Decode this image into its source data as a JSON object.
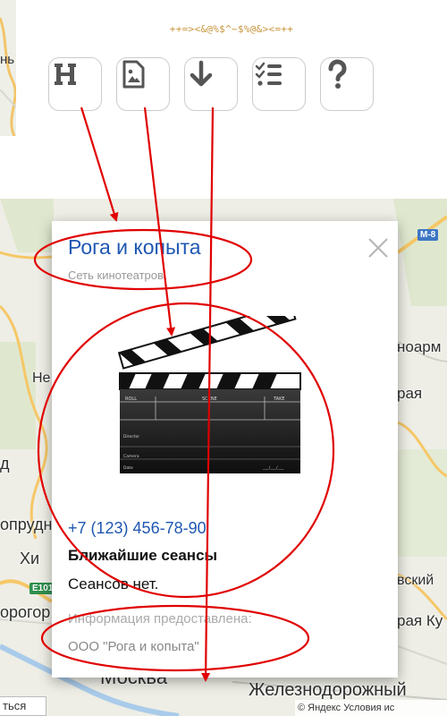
{
  "toolbar": {
    "caption": "++=><&@%$^~$%@&><=++",
    "buttons": [
      {
        "icon": "heading-icon",
        "label": "H"
      },
      {
        "icon": "image-file-icon"
      },
      {
        "icon": "arrow-down-icon"
      },
      {
        "icon": "checklist-icon"
      },
      {
        "icon": "question-icon",
        "label": "?"
      }
    ]
  },
  "map_top": {
    "label_fragment": "нь"
  },
  "map": {
    "labels": {
      "ne": "Не",
      "d": "д",
      "oprud": "опрудн",
      "khi": "Хи",
      "orogor": "орогор",
      "moskva": "Москва",
      "zheleznodorozhny": "Железнодорожный",
      "noarm": "ноарм",
      "paya": "рая",
      "rayaku": "рая Ку",
      "vsky": "вский",
      "m8": "М-8",
      "e101": "E101"
    },
    "footer_left": "ться",
    "footer_right": "© Яндекс Условия ис"
  },
  "balloon": {
    "title": "Рога и копыта",
    "subtitle": "Сеть кинотеатров",
    "clapper": {
      "roll": "ROLL",
      "scene": "SCENE",
      "take": "TAKE",
      "director": "Director",
      "camera": "Camera",
      "date": "Date",
      "date_blank": "___/___/___"
    },
    "phone": "+7 (123) 456-78-90",
    "sessions_heading": "Ближайшие сеансы",
    "sessions_text": "Сеансов нет.",
    "info_label": "Информация предоставлена:",
    "organization": "ООО \"Рога и копыта\""
  },
  "colors": {
    "link": "#1f57b3",
    "annotation": "#e00000",
    "caption": "#c8963c"
  }
}
